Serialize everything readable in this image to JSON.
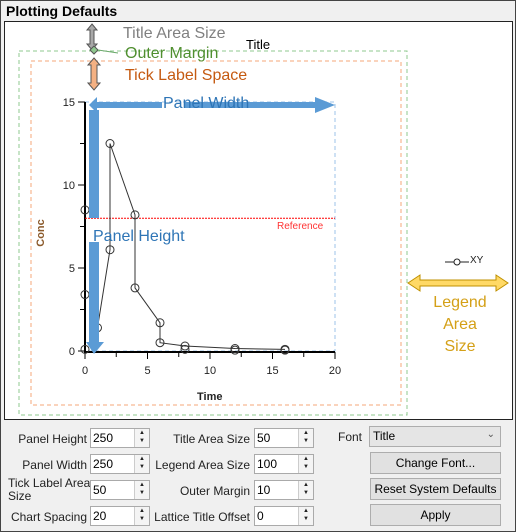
{
  "header": {
    "title": "Plotting Defaults"
  },
  "diagram": {
    "title_area": "Title Area Size",
    "outer_margin": "Outer Margin",
    "tick_label_space": "Tick Label Space",
    "panel_width": "Panel Width",
    "panel_height": "Panel Height",
    "legend_area": "Legend Area",
    "legend_area2": "Size",
    "chart_title": "Title",
    "legend_entry": "XY"
  },
  "chart_data": {
    "type": "line",
    "xlabel": "Time",
    "ylabel": "Conc",
    "xlim": [
      0,
      20
    ],
    "ylim": [
      0,
      15
    ],
    "xticks": [
      "0",
      "5",
      "10",
      "15",
      "20"
    ],
    "yticks": [
      "0",
      "5",
      "10",
      "15"
    ],
    "reference": {
      "label": "Reference",
      "y": 8,
      "color": "#ff0000"
    },
    "series": [
      {
        "name": "XY",
        "points": [
          [
            0,
            0.1
          ],
          [
            0,
            3.4
          ],
          [
            0,
            8.5
          ],
          [
            1,
            1.4
          ],
          [
            2,
            6.1
          ],
          [
            2,
            12.5
          ],
          [
            4,
            8.2
          ],
          [
            4,
            3.8
          ],
          [
            6,
            1.7
          ],
          [
            6,
            0.5
          ],
          [
            8,
            0.3
          ],
          [
            8,
            0.1
          ],
          [
            12,
            0.15
          ],
          [
            12,
            0.05
          ],
          [
            16,
            0.1
          ],
          [
            16,
            0.05
          ]
        ],
        "line": [
          [
            1,
            1.4
          ],
          [
            2,
            6.1
          ],
          [
            2,
            12.5
          ],
          [
            4,
            8.2
          ],
          [
            4,
            3.8
          ],
          [
            6,
            1.7
          ],
          [
            6,
            0.5
          ],
          [
            8,
            0.3
          ],
          [
            12,
            0.15
          ],
          [
            16,
            0.1
          ]
        ]
      }
    ]
  },
  "controls": {
    "panel_height": {
      "label": "Panel Height",
      "value": "250"
    },
    "panel_width": {
      "label": "Panel Width",
      "value": "250"
    },
    "tick_label": {
      "label1": "Tick Label Area",
      "label2": "Size",
      "value": "50"
    },
    "chart_spacing": {
      "label": "Chart Spacing",
      "value": "20"
    },
    "title_area": {
      "label": "Title Area Size",
      "value": "50"
    },
    "legend_area": {
      "label": "Legend Area Size",
      "value": "100"
    },
    "outer_margin": {
      "label": "Outer Margin",
      "value": "10"
    },
    "lattice": {
      "label": "Lattice Title Offset",
      "value": "0"
    },
    "font_label": "Font",
    "font_value": "Title",
    "change_font": "Change Font...",
    "reset": "Reset System Defaults",
    "apply": "Apply"
  }
}
